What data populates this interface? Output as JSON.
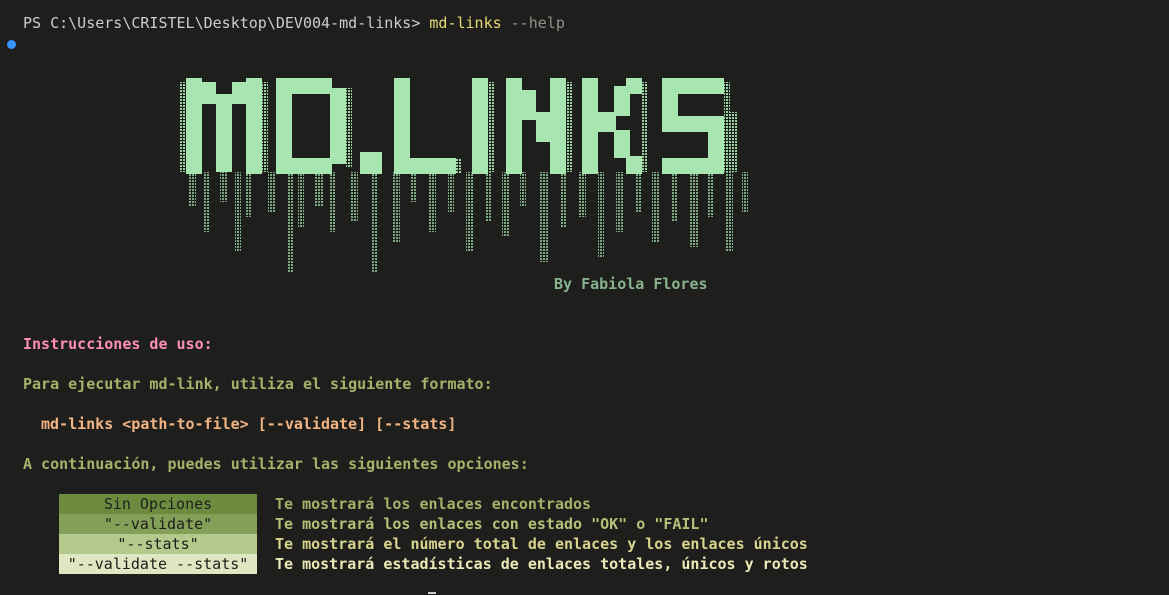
{
  "terminal": {
    "prompt_path": "PS C:\\Users\\CRISTEL\\Desktop\\DEV004-md-links> ",
    "command": "md-links",
    "argument": "--help"
  },
  "banner": {
    "text": "MD.LINKS",
    "color": "#a8e6b0",
    "author": "By Fabiola Flores"
  },
  "help": {
    "heading": "Instrucciones de uso:",
    "intro": "Para ejecutar md-link, utiliza el siguiente formato:",
    "usage": "md-links <path-to-file> [--validate] [--stats]",
    "options_intro": "A continuación, puedes utilizar las siguientes opciones:",
    "options": [
      {
        "label": "Sin Opciones",
        "description": "Te mostrará los enlaces encontrados"
      },
      {
        "label": "\"--validate\"",
        "description": "Te mostrará los enlaces con estado \"OK\" o \"FAIL\""
      },
      {
        "label": "\"--stats\"",
        "description": "Te mostrará el número total de enlaces y los enlaces únicos"
      },
      {
        "label": "\"--validate --stats\"",
        "description": "Te mostrará estadísticas de enlaces totales, únicos y rotos"
      }
    ]
  },
  "colors": {
    "background": "#1e1f1c",
    "heading": "#ff8fb4",
    "usage": "#f3b484",
    "text": "#a6b16a"
  }
}
